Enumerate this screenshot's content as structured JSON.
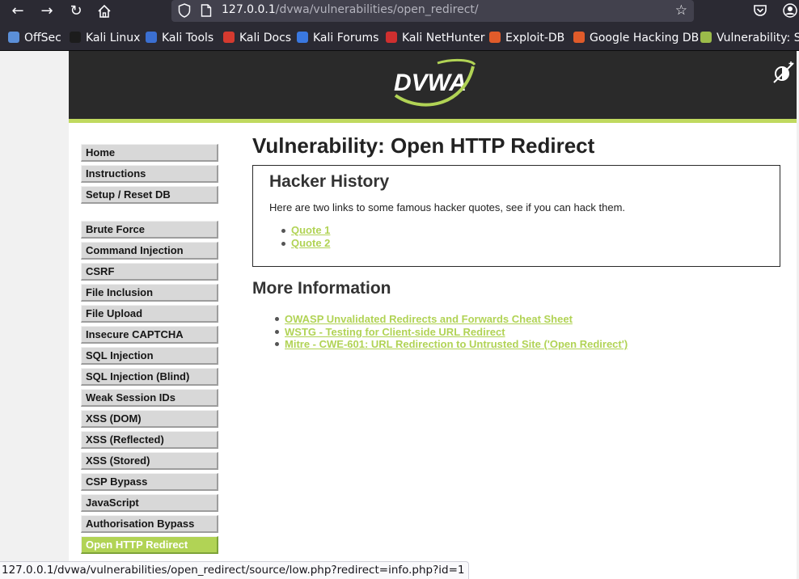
{
  "browser": {
    "url_host": "127.0.0.1",
    "url_path": "/dvwa/vulnerabilities/open_redirect/",
    "icons": [
      "back-icon",
      "forward-icon",
      "reload-icon",
      "home-icon",
      "shield-icon",
      "page-icon",
      "star-icon",
      "pocket-icon",
      "account-icon"
    ]
  },
  "bookmarks": [
    {
      "label": "OffSec",
      "color": "#5b8fd8"
    },
    {
      "label": "Kali Linux",
      "color": "#1c1c1c"
    },
    {
      "label": "Kali Tools",
      "color": "#3b6fd1"
    },
    {
      "label": "Kali Docs",
      "color": "#d53a2f"
    },
    {
      "label": "Kali Forums",
      "color": "#3a78e0"
    },
    {
      "label": "Kali NetHunter",
      "color": "#cf2f2f"
    },
    {
      "label": "Exploit-DB",
      "color": "#e05b2a"
    },
    {
      "label": "Google Hacking DB",
      "color": "#e05b2a"
    },
    {
      "label": "Vulnerability: St",
      "color": "#9bbb4a"
    }
  ],
  "menu": {
    "group1": [
      "Home",
      "Instructions",
      "Setup / Reset DB"
    ],
    "group2": [
      "Brute Force",
      "Command Injection",
      "CSRF",
      "File Inclusion",
      "File Upload",
      "Insecure CAPTCHA",
      "SQL Injection",
      "SQL Injection (Blind)",
      "Weak Session IDs",
      "XSS (DOM)",
      "XSS (Reflected)",
      "XSS (Stored)",
      "CSP Bypass",
      "JavaScript",
      "Authorisation Bypass",
      "Open HTTP Redirect"
    ],
    "selected": "Open HTTP Redirect"
  },
  "main": {
    "title": "Vulnerability: Open HTTP Redirect",
    "box_title": "Hacker History",
    "box_text": "Here are two links to some famous hacker quotes, see if you can hack them.",
    "quotes": [
      "Quote 1",
      "Quote 2"
    ],
    "more_title": "More Information",
    "more_links": [
      "OWASP Unvalidated Redirects and Forwards Cheat Sheet",
      "WSTG - Testing for Client-side URL Redirect",
      "Mitre - CWE-601: URL Redirection to Untrusted Site ('Open Redirect')"
    ]
  },
  "status_url": "127.0.0.1/dvwa/vulnerabilities/open_redirect/source/low.php?redirect=info.php?id=1",
  "colors": {
    "accent": "#b1d355",
    "header": "#2a2a2a",
    "chrome": "#2b2a33"
  }
}
